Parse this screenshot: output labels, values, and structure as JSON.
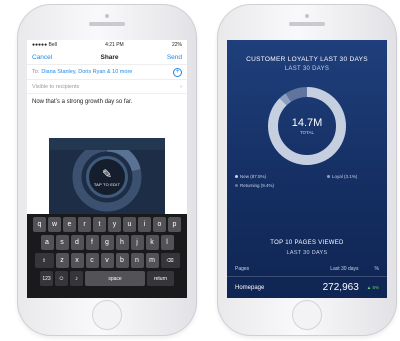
{
  "left_phone": {
    "status": {
      "carrier": "●●●●● Bell",
      "time": "4:21 PM",
      "battery": "22%"
    },
    "nav": {
      "cancel": "Cancel",
      "title": "Share",
      "send": "Send"
    },
    "to": {
      "label": "To:",
      "value": "Diana Stanley, Doris Ryan & 10 more"
    },
    "visibility": "Visible to recipients",
    "message": "Now that’s a strong growth day so far.",
    "attachment": {
      "tap_label": "TAP TO EDIT",
      "icon": "paintbrush-icon"
    },
    "keyboard": {
      "row1": [
        "q",
        "w",
        "e",
        "r",
        "t",
        "y",
        "u",
        "i",
        "o",
        "p"
      ],
      "row2": [
        "a",
        "s",
        "d",
        "f",
        "g",
        "h",
        "j",
        "k",
        "l"
      ],
      "row3": [
        "z",
        "x",
        "c",
        "v",
        "b",
        "n",
        "m"
      ],
      "numbers": "123",
      "space": "space",
      "return": "return"
    }
  },
  "right_phone": {
    "title": "CUSTOMER LOYALTY LAST 30 DAYS",
    "subtitle": "LAST 30 DAYS",
    "total_value": "14.7M",
    "total_label": "TOTAL",
    "legend": [
      {
        "label": "New (87.5%)",
        "color": "#c6cfe0"
      },
      {
        "label": "Loyal (3.1%)",
        "color": "#8da0c2"
      },
      {
        "label": "Returning (9.4%)",
        "color": "#5f759d"
      }
    ],
    "section2_title": "TOP 10 PAGES VIEWED",
    "section2_subtitle": "LAST 30 DAYS",
    "table_headers": {
      "pages": "Pages",
      "period": "Last 30 days",
      "pct": "%"
    },
    "top_row": {
      "page": "Homepage",
      "value": "272,963",
      "change": "▲ 5%"
    }
  },
  "chart_data": {
    "type": "pie",
    "series": [
      {
        "name": "New",
        "value": 87.5
      },
      {
        "name": "Loyal",
        "value": 3.1
      },
      {
        "name": "Returning",
        "value": 9.4
      }
    ]
  },
  "colors": {
    "accent": "#1e88e5",
    "dashboard_bg": "#1a3670",
    "positive": "#5fd86f"
  }
}
